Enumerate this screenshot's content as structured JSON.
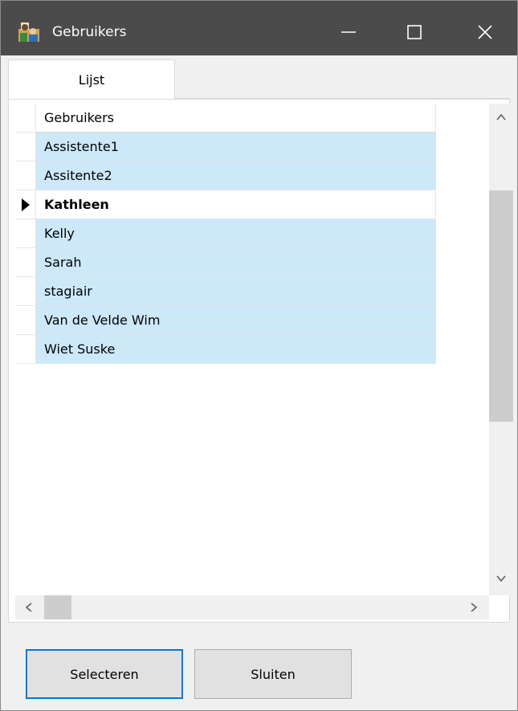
{
  "window": {
    "title": "Gebruikers",
    "titlebar_color": "#4b4b4b"
  },
  "tabs": [
    {
      "label": "Lijst",
      "active": true
    }
  ],
  "grid": {
    "column_header": "Gebruikers",
    "rows": [
      {
        "name": "Assistente1",
        "selected": true,
        "current": false
      },
      {
        "name": "Assitente2",
        "selected": true,
        "current": false
      },
      {
        "name": "Kathleen",
        "selected": false,
        "current": true
      },
      {
        "name": "Kelly",
        "selected": true,
        "current": false
      },
      {
        "name": "Sarah",
        "selected": true,
        "current": false
      },
      {
        "name": "stagiair",
        "selected": true,
        "current": false
      },
      {
        "name": "Van de Velde Wim",
        "selected": true,
        "current": false
      },
      {
        "name": "Wiet Suske",
        "selected": true,
        "current": false
      }
    ],
    "selection_color": "#cce8f9"
  },
  "buttons": {
    "select_label": "Selecteren",
    "close_label": "Sluiten"
  },
  "icons": {
    "app": "users-icon",
    "minimize": "minimize-icon",
    "maximize": "maximize-icon",
    "close": "close-icon",
    "row_pointer": "row-pointer-icon"
  },
  "accent_color": "#0078d7"
}
